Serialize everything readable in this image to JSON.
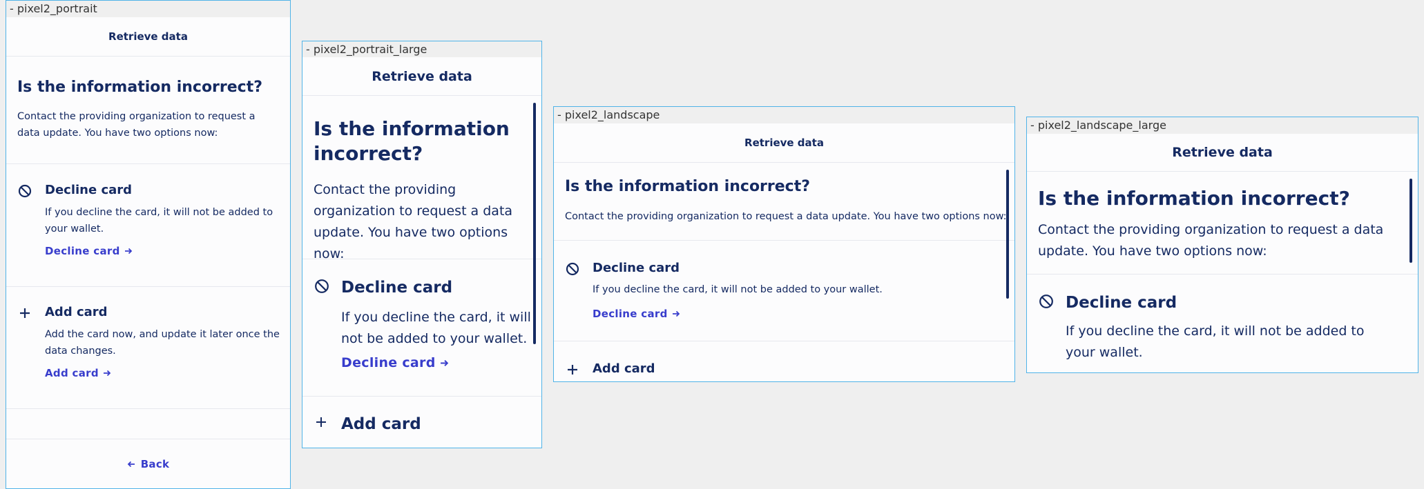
{
  "frames": [
    {
      "label": "- pixel2_portrait",
      "header_title": "Retrieve data",
      "title": "Is the information incorrect?",
      "description": "Contact the providing organization to request a data update. You have two options now:",
      "decline": {
        "title": "Decline card",
        "description": "If you decline the card, it will not be added to your wallet.",
        "link": "Decline card",
        "icon": "block-icon"
      },
      "add": {
        "title": "Add card",
        "description": "Add the card now, and update it later once the data changes.",
        "link": "Add card",
        "icon": "plus-icon"
      },
      "back_label": "Back"
    },
    {
      "label": "- pixel2_portrait_large",
      "header_title": "Retrieve data",
      "title": "Is the information incorrect?",
      "description": "Contact the providing organization to request a data update. You have two options now:",
      "decline": {
        "title": "Decline card",
        "description": "If you decline the card, it will not be added to your wallet.",
        "link": "Decline card",
        "icon": "block-icon"
      },
      "add": {
        "title": "Add card",
        "icon": "plus-icon"
      }
    },
    {
      "label": "- pixel2_landscape",
      "header_title": "Retrieve data",
      "title": "Is the information incorrect?",
      "description": "Contact the providing organization to request a data update. You have two options now:",
      "decline": {
        "title": "Decline card",
        "description": "If you decline the card, it will not be added to your wallet.",
        "link": "Decline card",
        "icon": "block-icon"
      },
      "add": {
        "title": "Add card",
        "icon": "plus-icon"
      }
    },
    {
      "label": "- pixel2_landscape_large",
      "header_title": "Retrieve data",
      "title": "Is the information incorrect?",
      "description": "Contact the providing organization to request a data update. You have two options now:",
      "decline": {
        "title": "Decline card",
        "description": "If you decline the card, it will not be added to your wallet.",
        "icon": "block-icon"
      }
    }
  ],
  "colors": {
    "navy": "#152a62",
    "link": "#383dcc",
    "frame_border": "#4fb3e8",
    "background": "#efefef",
    "surface": "#fcfcfd"
  }
}
